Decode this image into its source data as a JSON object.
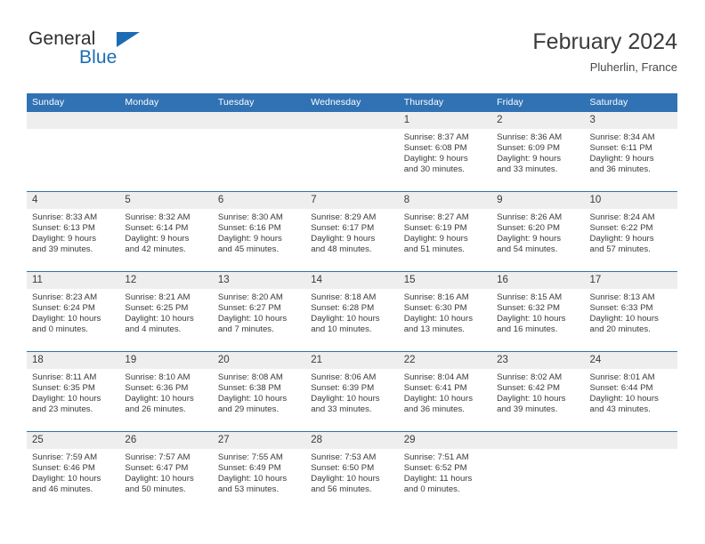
{
  "brand": {
    "name_part1": "General",
    "name_part2": "Blue",
    "logo_icon": "triangle-flag-icon",
    "accent_color": "#1b6cb3"
  },
  "header": {
    "title": "February 2024",
    "subtitle": "Pluherlin, France"
  },
  "theme": {
    "header_blue": "#3072b4",
    "daynum_band": "#eeeeee",
    "text": "#3a3a3a"
  },
  "calendar": {
    "weekday_headers": [
      "Sunday",
      "Monday",
      "Tuesday",
      "Wednesday",
      "Thursday",
      "Friday",
      "Saturday"
    ],
    "weeks": [
      [
        {
          "day": "",
          "empty": true,
          "sunrise": "",
          "sunset": "",
          "daylight_line1": "",
          "daylight_line2": ""
        },
        {
          "day": "",
          "empty": true,
          "sunrise": "",
          "sunset": "",
          "daylight_line1": "",
          "daylight_line2": ""
        },
        {
          "day": "",
          "empty": true,
          "sunrise": "",
          "sunset": "",
          "daylight_line1": "",
          "daylight_line2": ""
        },
        {
          "day": "",
          "empty": true,
          "sunrise": "",
          "sunset": "",
          "daylight_line1": "",
          "daylight_line2": ""
        },
        {
          "day": "1",
          "empty": false,
          "sunrise": "Sunrise: 8:37 AM",
          "sunset": "Sunset: 6:08 PM",
          "daylight_line1": "Daylight: 9 hours",
          "daylight_line2": "and 30 minutes."
        },
        {
          "day": "2",
          "empty": false,
          "sunrise": "Sunrise: 8:36 AM",
          "sunset": "Sunset: 6:09 PM",
          "daylight_line1": "Daylight: 9 hours",
          "daylight_line2": "and 33 minutes."
        },
        {
          "day": "3",
          "empty": false,
          "sunrise": "Sunrise: 8:34 AM",
          "sunset": "Sunset: 6:11 PM",
          "daylight_line1": "Daylight: 9 hours",
          "daylight_line2": "and 36 minutes."
        }
      ],
      [
        {
          "day": "4",
          "empty": false,
          "sunrise": "Sunrise: 8:33 AM",
          "sunset": "Sunset: 6:13 PM",
          "daylight_line1": "Daylight: 9 hours",
          "daylight_line2": "and 39 minutes."
        },
        {
          "day": "5",
          "empty": false,
          "sunrise": "Sunrise: 8:32 AM",
          "sunset": "Sunset: 6:14 PM",
          "daylight_line1": "Daylight: 9 hours",
          "daylight_line2": "and 42 minutes."
        },
        {
          "day": "6",
          "empty": false,
          "sunrise": "Sunrise: 8:30 AM",
          "sunset": "Sunset: 6:16 PM",
          "daylight_line1": "Daylight: 9 hours",
          "daylight_line2": "and 45 minutes."
        },
        {
          "day": "7",
          "empty": false,
          "sunrise": "Sunrise: 8:29 AM",
          "sunset": "Sunset: 6:17 PM",
          "daylight_line1": "Daylight: 9 hours",
          "daylight_line2": "and 48 minutes."
        },
        {
          "day": "8",
          "empty": false,
          "sunrise": "Sunrise: 8:27 AM",
          "sunset": "Sunset: 6:19 PM",
          "daylight_line1": "Daylight: 9 hours",
          "daylight_line2": "and 51 minutes."
        },
        {
          "day": "9",
          "empty": false,
          "sunrise": "Sunrise: 8:26 AM",
          "sunset": "Sunset: 6:20 PM",
          "daylight_line1": "Daylight: 9 hours",
          "daylight_line2": "and 54 minutes."
        },
        {
          "day": "10",
          "empty": false,
          "sunrise": "Sunrise: 8:24 AM",
          "sunset": "Sunset: 6:22 PM",
          "daylight_line1": "Daylight: 9 hours",
          "daylight_line2": "and 57 minutes."
        }
      ],
      [
        {
          "day": "11",
          "empty": false,
          "sunrise": "Sunrise: 8:23 AM",
          "sunset": "Sunset: 6:24 PM",
          "daylight_line1": "Daylight: 10 hours",
          "daylight_line2": "and 0 minutes."
        },
        {
          "day": "12",
          "empty": false,
          "sunrise": "Sunrise: 8:21 AM",
          "sunset": "Sunset: 6:25 PM",
          "daylight_line1": "Daylight: 10 hours",
          "daylight_line2": "and 4 minutes."
        },
        {
          "day": "13",
          "empty": false,
          "sunrise": "Sunrise: 8:20 AM",
          "sunset": "Sunset: 6:27 PM",
          "daylight_line1": "Daylight: 10 hours",
          "daylight_line2": "and 7 minutes."
        },
        {
          "day": "14",
          "empty": false,
          "sunrise": "Sunrise: 8:18 AM",
          "sunset": "Sunset: 6:28 PM",
          "daylight_line1": "Daylight: 10 hours",
          "daylight_line2": "and 10 minutes."
        },
        {
          "day": "15",
          "empty": false,
          "sunrise": "Sunrise: 8:16 AM",
          "sunset": "Sunset: 6:30 PM",
          "daylight_line1": "Daylight: 10 hours",
          "daylight_line2": "and 13 minutes."
        },
        {
          "day": "16",
          "empty": false,
          "sunrise": "Sunrise: 8:15 AM",
          "sunset": "Sunset: 6:32 PM",
          "daylight_line1": "Daylight: 10 hours",
          "daylight_line2": "and 16 minutes."
        },
        {
          "day": "17",
          "empty": false,
          "sunrise": "Sunrise: 8:13 AM",
          "sunset": "Sunset: 6:33 PM",
          "daylight_line1": "Daylight: 10 hours",
          "daylight_line2": "and 20 minutes."
        }
      ],
      [
        {
          "day": "18",
          "empty": false,
          "sunrise": "Sunrise: 8:11 AM",
          "sunset": "Sunset: 6:35 PM",
          "daylight_line1": "Daylight: 10 hours",
          "daylight_line2": "and 23 minutes."
        },
        {
          "day": "19",
          "empty": false,
          "sunrise": "Sunrise: 8:10 AM",
          "sunset": "Sunset: 6:36 PM",
          "daylight_line1": "Daylight: 10 hours",
          "daylight_line2": "and 26 minutes."
        },
        {
          "day": "20",
          "empty": false,
          "sunrise": "Sunrise: 8:08 AM",
          "sunset": "Sunset: 6:38 PM",
          "daylight_line1": "Daylight: 10 hours",
          "daylight_line2": "and 29 minutes."
        },
        {
          "day": "21",
          "empty": false,
          "sunrise": "Sunrise: 8:06 AM",
          "sunset": "Sunset: 6:39 PM",
          "daylight_line1": "Daylight: 10 hours",
          "daylight_line2": "and 33 minutes."
        },
        {
          "day": "22",
          "empty": false,
          "sunrise": "Sunrise: 8:04 AM",
          "sunset": "Sunset: 6:41 PM",
          "daylight_line1": "Daylight: 10 hours",
          "daylight_line2": "and 36 minutes."
        },
        {
          "day": "23",
          "empty": false,
          "sunrise": "Sunrise: 8:02 AM",
          "sunset": "Sunset: 6:42 PM",
          "daylight_line1": "Daylight: 10 hours",
          "daylight_line2": "and 39 minutes."
        },
        {
          "day": "24",
          "empty": false,
          "sunrise": "Sunrise: 8:01 AM",
          "sunset": "Sunset: 6:44 PM",
          "daylight_line1": "Daylight: 10 hours",
          "daylight_line2": "and 43 minutes."
        }
      ],
      [
        {
          "day": "25",
          "empty": false,
          "sunrise": "Sunrise: 7:59 AM",
          "sunset": "Sunset: 6:46 PM",
          "daylight_line1": "Daylight: 10 hours",
          "daylight_line2": "and 46 minutes."
        },
        {
          "day": "26",
          "empty": false,
          "sunrise": "Sunrise: 7:57 AM",
          "sunset": "Sunset: 6:47 PM",
          "daylight_line1": "Daylight: 10 hours",
          "daylight_line2": "and 50 minutes."
        },
        {
          "day": "27",
          "empty": false,
          "sunrise": "Sunrise: 7:55 AM",
          "sunset": "Sunset: 6:49 PM",
          "daylight_line1": "Daylight: 10 hours",
          "daylight_line2": "and 53 minutes."
        },
        {
          "day": "28",
          "empty": false,
          "sunrise": "Sunrise: 7:53 AM",
          "sunset": "Sunset: 6:50 PM",
          "daylight_line1": "Daylight: 10 hours",
          "daylight_line2": "and 56 minutes."
        },
        {
          "day": "29",
          "empty": false,
          "sunrise": "Sunrise: 7:51 AM",
          "sunset": "Sunset: 6:52 PM",
          "daylight_line1": "Daylight: 11 hours",
          "daylight_line2": "and 0 minutes."
        },
        {
          "day": "",
          "empty": true,
          "sunrise": "",
          "sunset": "",
          "daylight_line1": "",
          "daylight_line2": ""
        },
        {
          "day": "",
          "empty": true,
          "sunrise": "",
          "sunset": "",
          "daylight_line1": "",
          "daylight_line2": ""
        }
      ]
    ]
  }
}
